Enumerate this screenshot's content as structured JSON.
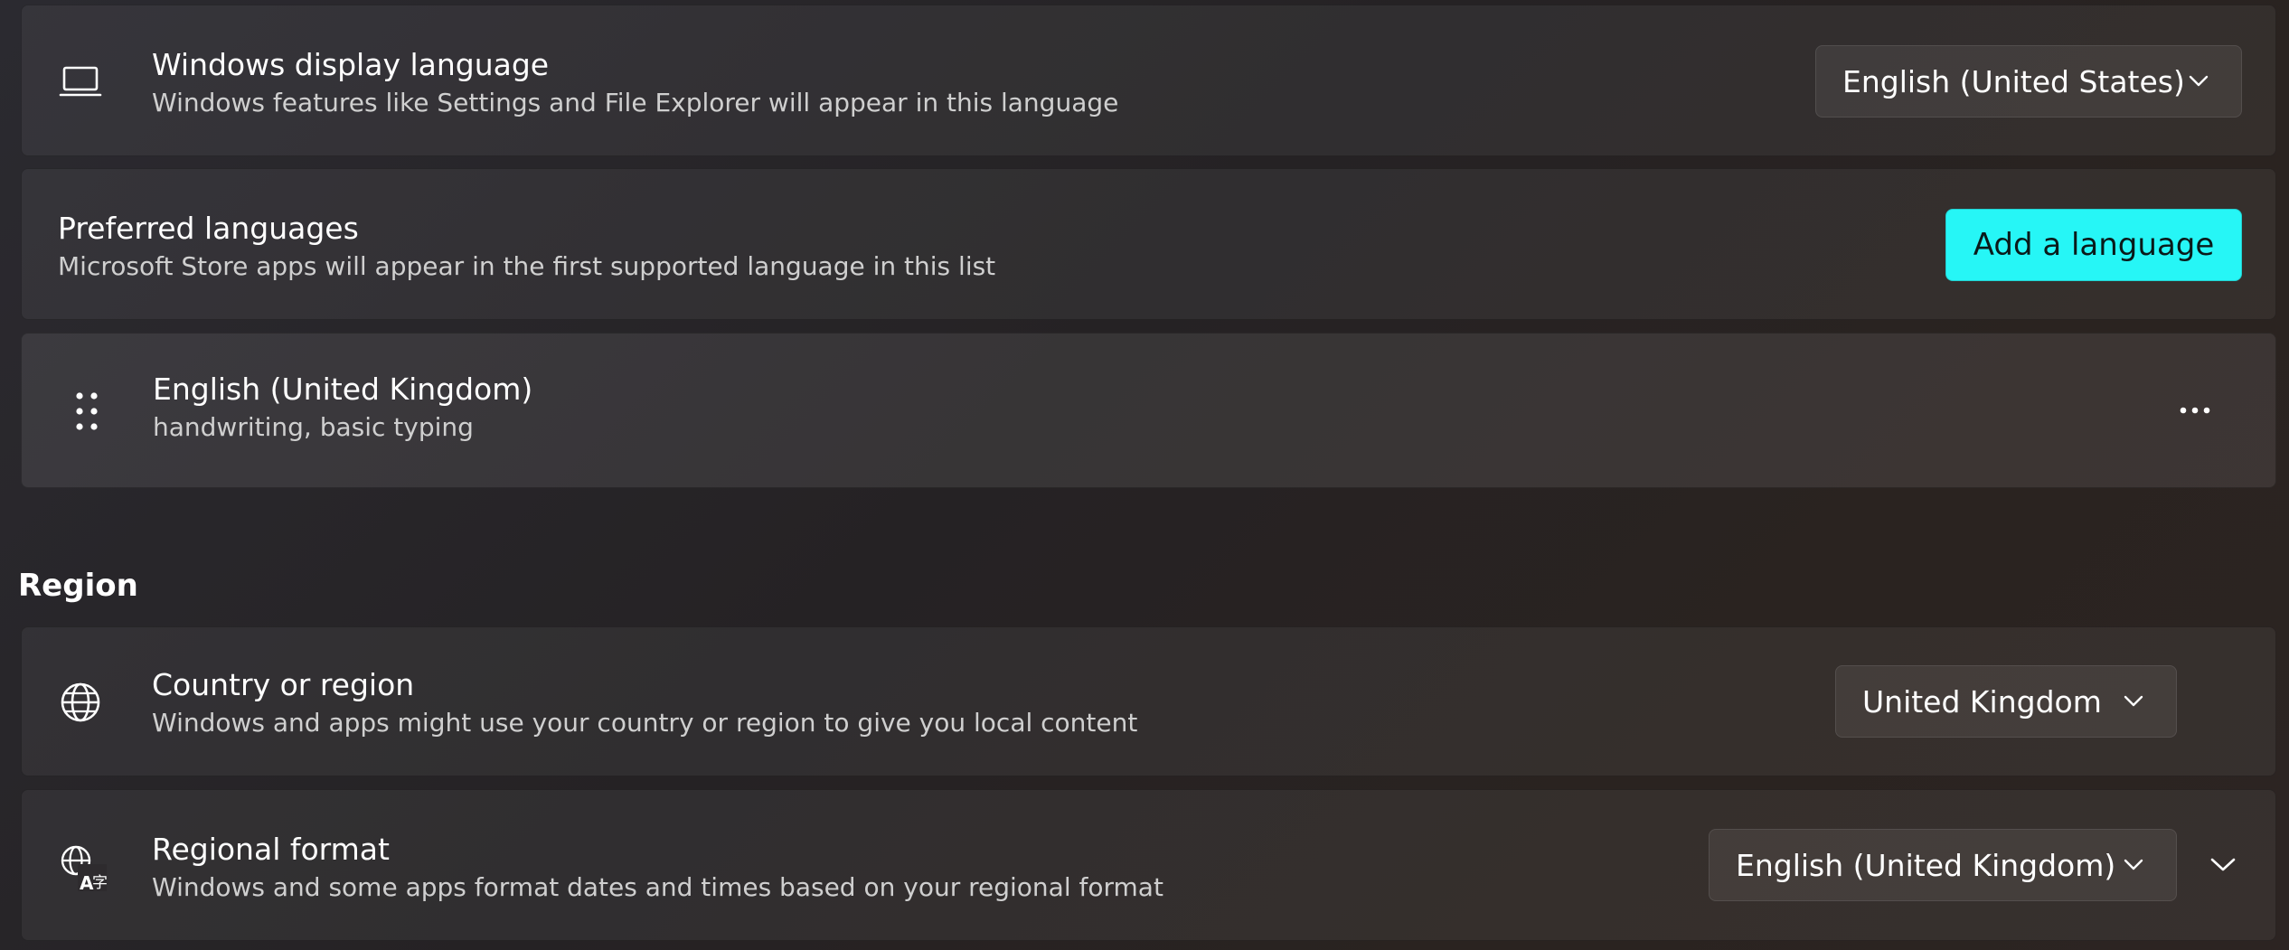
{
  "display_language": {
    "title": "Windows display language",
    "description": "Windows features like Settings and File Explorer will appear in this language",
    "selected": "English (United States)",
    "icon": "laptop-icon"
  },
  "preferred_languages": {
    "title": "Preferred languages",
    "description": "Microsoft Store apps will appear in the first supported language in this list",
    "add_button": "Add a language",
    "accent_color": "#26f6f6"
  },
  "language_list": [
    {
      "name": "English (United Kingdom)",
      "features": "handwriting, basic typing",
      "icon": "drag-handle-icon",
      "more_icon": "more-options-icon"
    }
  ],
  "region": {
    "header": "Region",
    "country": {
      "title": "Country or region",
      "description": "Windows and apps might use your country or region to give you local content",
      "selected": "United Kingdom",
      "icon": "globe-icon"
    },
    "regional_format": {
      "title": "Regional format",
      "description": "Windows and some apps format dates and times based on your regional format",
      "selected": "English (United Kingdom)",
      "icon": "language-globe-icon"
    }
  }
}
